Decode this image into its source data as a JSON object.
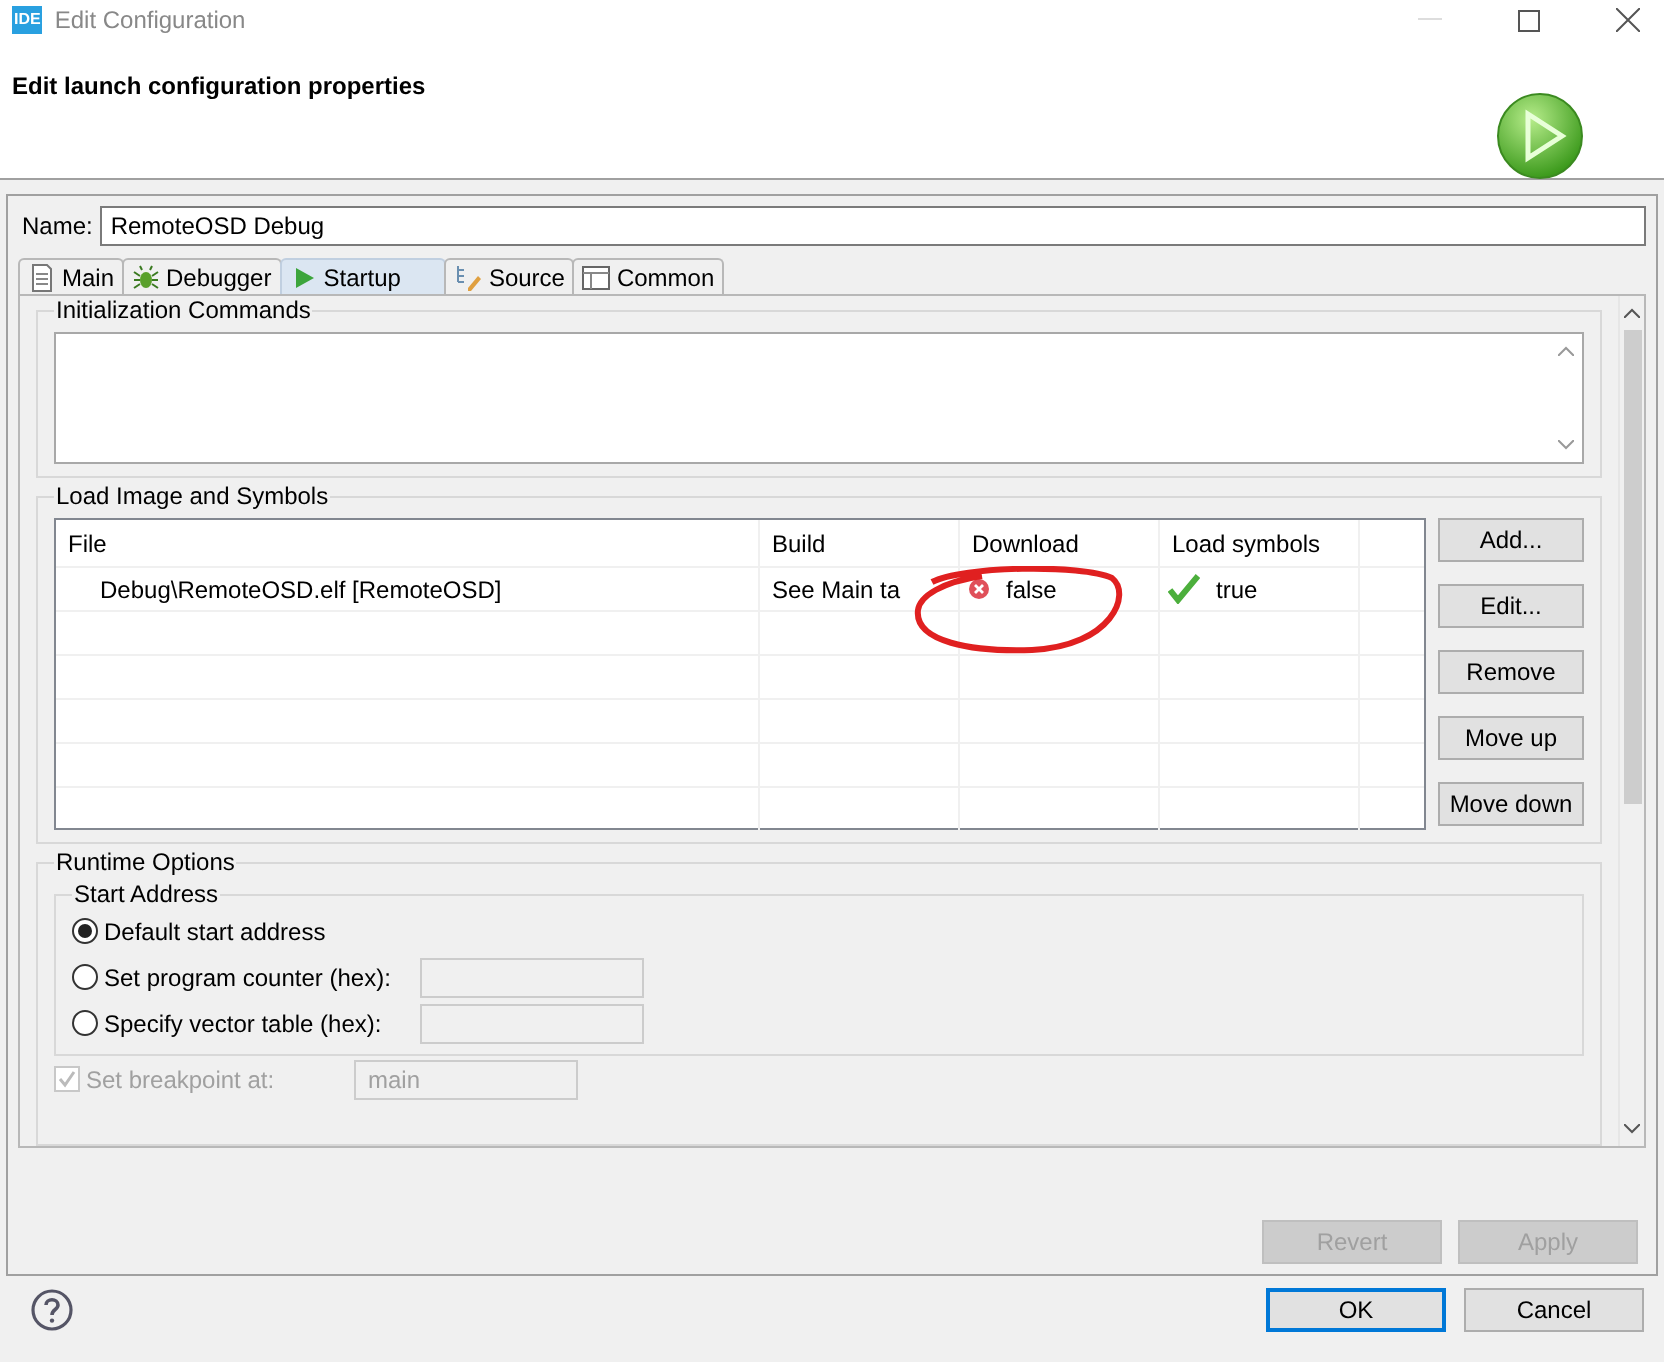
{
  "window": {
    "badge": "IDE",
    "title": "Edit Configuration"
  },
  "header": {
    "title": "Edit launch configuration properties"
  },
  "name_field": {
    "label": "Name:",
    "value": "RemoteOSD Debug"
  },
  "tabs": [
    {
      "label": "Main",
      "kind": "doc",
      "selected": false
    },
    {
      "label": "Debugger",
      "kind": "bug",
      "selected": false
    },
    {
      "label": "Startup",
      "kind": "play",
      "selected": true
    },
    {
      "label": "Source",
      "kind": "source",
      "selected": false
    },
    {
      "label": "Common",
      "kind": "table",
      "selected": false
    }
  ],
  "init_commands": {
    "title": "Initialization Commands"
  },
  "load_image": {
    "title": "Load Image and Symbols",
    "columns": [
      "File",
      "Build",
      "Download",
      "Load symbols"
    ],
    "rows": [
      {
        "file": "Debug\\RemoteOSD.elf [RemoteOSD]",
        "build": "See Main ta",
        "download": {
          "value": "false",
          "ok": false
        },
        "load_symbols": {
          "value": "true",
          "ok": true
        }
      }
    ],
    "buttons": [
      "Add...",
      "Edit...",
      "Remove",
      "Move up",
      "Move down"
    ]
  },
  "runtime_options": {
    "title": "Runtime Options",
    "start_address": {
      "title": "Start Address",
      "options": [
        {
          "label": "Default start address",
          "selected": true,
          "kind": "plain"
        },
        {
          "label": "Set program counter (hex):",
          "selected": false,
          "kind": "field"
        },
        {
          "label": "Specify vector table (hex):",
          "selected": false,
          "kind": "field"
        }
      ]
    },
    "breakpoint": {
      "label": "Set breakpoint at:",
      "checked": true,
      "disabled": true,
      "value": "main"
    }
  },
  "actions": [
    {
      "label": "Revert",
      "disabled": true
    },
    {
      "label": "Apply",
      "disabled": true
    }
  ],
  "dialog_buttons": [
    {
      "label": "OK",
      "default": true
    },
    {
      "label": "Cancel",
      "default": false
    }
  ]
}
